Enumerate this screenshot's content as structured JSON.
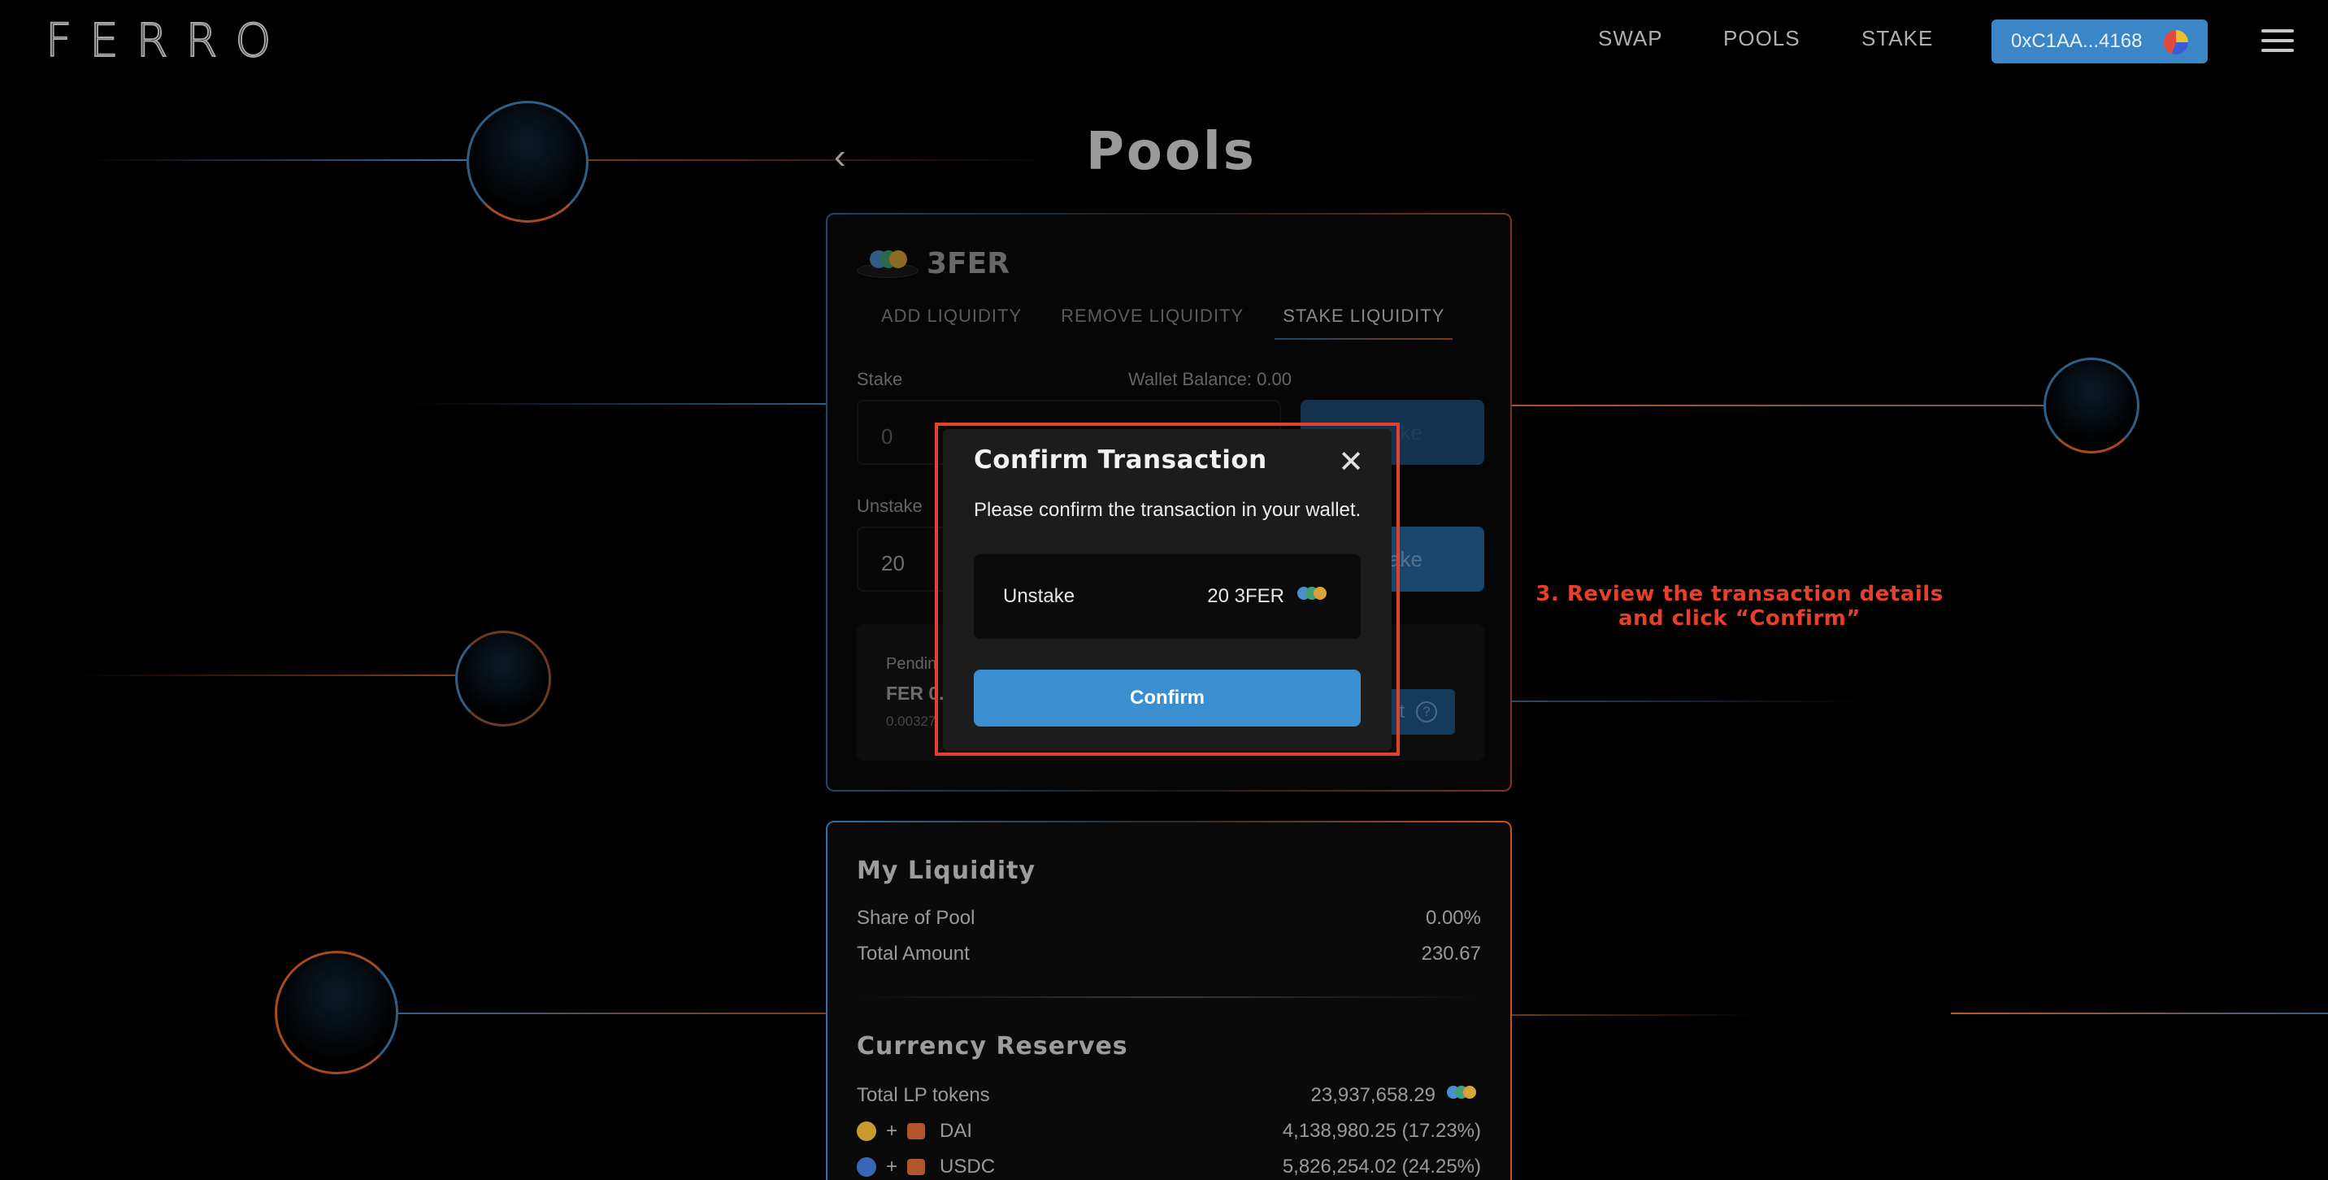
{
  "header": {
    "logo": "FERRO",
    "nav": [
      "SWAP",
      "POOLS",
      "STAKE"
    ],
    "wallet_address": "0xC1AA...4168"
  },
  "page": {
    "title": "Pools",
    "back_icon": "chevron-left-icon"
  },
  "pool": {
    "name": "3FER",
    "tabs": [
      "ADD LIQUIDITY",
      "REMOVE LIQUIDITY",
      "STAKE LIQUIDITY"
    ],
    "active_tab": "STAKE LIQUIDITY",
    "stake_label": "Stake",
    "wallet_balance": "Wallet Balance: 0.00",
    "stake_placeholder": "0",
    "stake_button": "ke",
    "unstake_label": "Unstake",
    "unstake_value": "20",
    "unstake_button": "ake",
    "pending_label": "Pendin",
    "pending_value": "FER 0.0",
    "pending_sub": "0.00327",
    "claim_button": "t"
  },
  "my_liquidity": {
    "title": "My Liquidity",
    "rows": [
      {
        "label": "Share of Pool",
        "value": "0.00%"
      },
      {
        "label": "Total Amount",
        "value": "230.67"
      }
    ]
  },
  "currency_reserves": {
    "title": "Currency Reserves",
    "total_lp_label": "Total LP tokens",
    "total_lp_value": "23,937,658.29",
    "rows": [
      {
        "name": "DAI",
        "value": "4,138,980.25 (17.23%)"
      },
      {
        "name": "USDC",
        "value": "5,826,254.02 (24.25%)"
      }
    ]
  },
  "modal": {
    "title": "Confirm Transaction",
    "message": "Please confirm the transaction in your wallet.",
    "tx_label": "Unstake",
    "tx_amount": "20 3FER",
    "confirm_label": "Confirm"
  },
  "annotation": {
    "line1": "3. Review the transaction details",
    "line2": "and click “Confirm”"
  },
  "colors": {
    "accent_blue": "#3b8fd1",
    "highlight_red": "#e5402a"
  }
}
